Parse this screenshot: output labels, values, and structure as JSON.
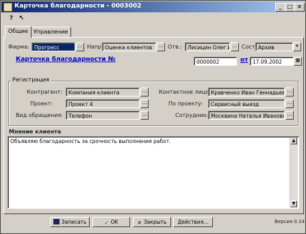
{
  "window": {
    "title": "Карточка благодарности - 0003002"
  },
  "title_buttons": [
    "_",
    "□",
    "×"
  ],
  "toolbar": {
    "help_icon": "?",
    "pointer_icon": "↖"
  },
  "tabs": [
    "Общие",
    "Управление"
  ],
  "header": {
    "firm_label": "Фирма:",
    "firm_value": "Прогресс",
    "direction_label": "Напр.:",
    "direction_value": "Оценка клиентов",
    "resp_label": "Отв.:",
    "resp_value": "Лисицин Олег И.",
    "state_label": "Сост.:",
    "state_value": "Архив",
    "card_link": "Карточка благодарности №",
    "card_number": "0000002",
    "date_from_label": "от",
    "date_value": "17.09.2002"
  },
  "registration": {
    "title": "Регистрация",
    "counterparty_label": "Контрагент:",
    "counterparty_value": "Компания клиента",
    "project_label": "Проект:",
    "project_value": "Проект 4",
    "contact_label": "Контактное лицо:",
    "contact_value": "Кравченко Иван Геннадьев",
    "subject_label": "По проекту:",
    "subject_value": "Сервисный выезд",
    "channel_label": "Вид обращения:",
    "channel_value": "Телефон",
    "employee_label": "Сотрудник:",
    "employee_value": "Москвина Наталья Ивановн"
  },
  "opinion": {
    "title": "Мнение клиента",
    "text": "Объявляю благодарность за срочность выполнения работ."
  },
  "buttons": {
    "save": "Записать",
    "ok": "OK",
    "close": "Закрыть",
    "actions": "Действия..."
  },
  "status": {
    "version": "Версия 0.14"
  },
  "colors": {
    "title_start": "#0a246a",
    "title_end": "#a6caf0",
    "link": "#0000c0",
    "face": "#d4d0c8"
  }
}
